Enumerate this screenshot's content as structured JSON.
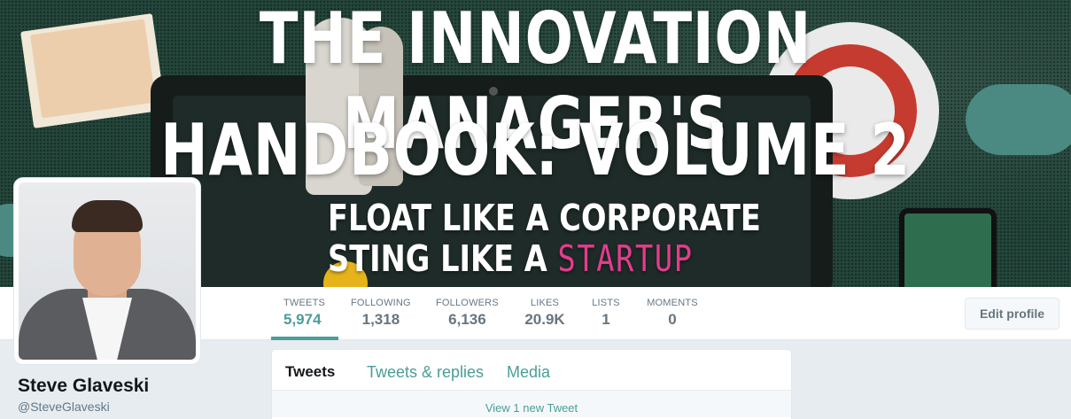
{
  "banner": {
    "title_line1": "THE INNOVATION MANAGER'S",
    "title_line2": "HANDBOOK: VOLUME 2",
    "tagline_line1": "FLOAT LIKE A CORPORATE",
    "tagline_line2_prefix": "STING LIKE A ",
    "tagline_line2_highlight": "STARTUP",
    "highlight_color": "#e53c8d"
  },
  "stats": [
    {
      "label": "TWEETS",
      "value": "5,974"
    },
    {
      "label": "FOLLOWING",
      "value": "1,318"
    },
    {
      "label": "FOLLOWERS",
      "value": "6,136"
    },
    {
      "label": "LIKES",
      "value": "20.9K"
    },
    {
      "label": "LISTS",
      "value": "1"
    },
    {
      "label": "MOMENTS",
      "value": "0"
    }
  ],
  "edit_profile_label": "Edit profile",
  "profile": {
    "name": "Steve Glaveski",
    "handle": "@SteveGlaveski"
  },
  "timeline": {
    "tabs": [
      "Tweets",
      "Tweets & replies",
      "Media"
    ],
    "new_tweets": "View 1 new Tweet"
  },
  "colors": {
    "accent": "#4a9d98",
    "background": "#e6ecf0"
  }
}
